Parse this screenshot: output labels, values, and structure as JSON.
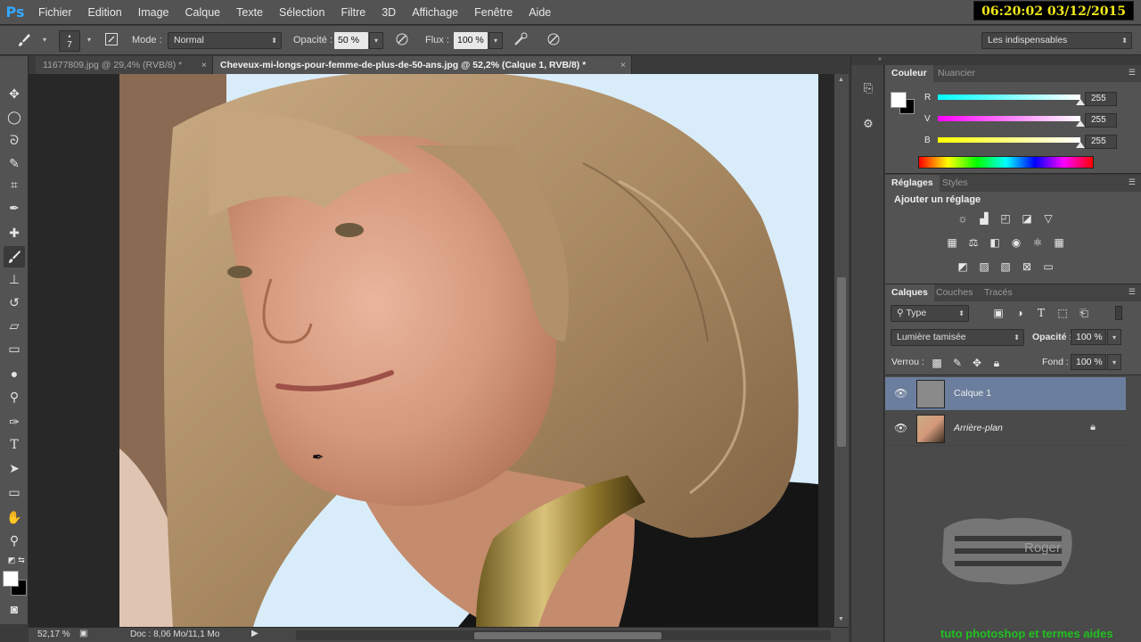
{
  "app": {
    "logo": "Ps",
    "clock": "06:20:02 03/12/2015"
  },
  "menu": [
    "Fichier",
    "Edition",
    "Image",
    "Calque",
    "Texte",
    "Sélection",
    "Filtre",
    "3D",
    "Affichage",
    "Fenêtre",
    "Aide"
  ],
  "options": {
    "brush_size": "7",
    "mode_label": "Mode :",
    "mode_value": "Normal",
    "opacity_label": "Opacité :",
    "opacity_value": "50 %",
    "flow_label": "Flux :",
    "flow_value": "100 %",
    "workspace": "Les indispensables"
  },
  "tabs": [
    {
      "label": "11677809.jpg @ 29,4% (RVB/8) *",
      "active": false
    },
    {
      "label": "Cheveux-mi-longs-pour-femme-de-plus-de-50-ans.jpg @ 52,2% (Calque 1, RVB/8) *",
      "active": true
    }
  ],
  "status": {
    "zoom": "52,17 %",
    "doc": "Doc : 8,06 Mo/11,1 Mo"
  },
  "color_panel": {
    "tabs": [
      "Couleur",
      "Nuancier"
    ],
    "channels": [
      {
        "label": "R",
        "value": "255"
      },
      {
        "label": "V",
        "value": "255"
      },
      {
        "label": "B",
        "value": "255"
      }
    ]
  },
  "adjust_panel": {
    "tabs": [
      "Réglages",
      "Styles"
    ],
    "title": "Ajouter un réglage"
  },
  "layers_panel": {
    "tabs": [
      "Calques",
      "Couches",
      "Tracés"
    ],
    "filter": "Type",
    "blend_mode": "Lumière tamisée",
    "opacity_label": "Opacité :",
    "opacity_value": "100 %",
    "lock_label": "Verrou :",
    "fill_label": "Fond :",
    "fill_value": "100 %",
    "layers": [
      {
        "name": "Calque 1",
        "selected": true
      },
      {
        "name": "Arrière-plan",
        "selected": false
      }
    ]
  },
  "watermark": {
    "brand": "Roger",
    "text": "tuto photoshop et termes aides"
  },
  "colors": {
    "accent_selected": "#6b7e9d",
    "clock_text": "#f0e818",
    "watermark_text": "#20c020"
  }
}
